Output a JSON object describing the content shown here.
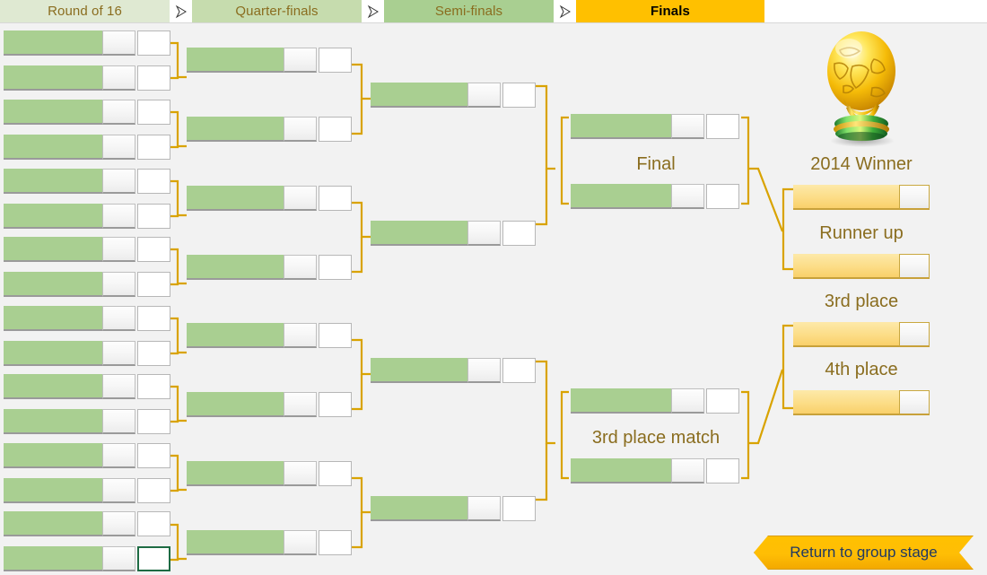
{
  "header": {
    "tabs": [
      {
        "label": "Round of 16",
        "key": "r16"
      },
      {
        "label": "Quarter-finals",
        "key": "qf"
      },
      {
        "label": "Semi-finals",
        "key": "sf"
      },
      {
        "label": "Finals",
        "key": "finals"
      }
    ],
    "separator_icon": "chevron-right-icon"
  },
  "labels": {
    "final": "Final",
    "third_place_match": "3rd place match",
    "winner": "2014 Winner",
    "runner_up": "Runner up",
    "third_place": "3rd place",
    "fourth_place": "4th place"
  },
  "trophy": {
    "icon": "world-cup-trophy-icon",
    "alt": "FIFA World Cup trophy"
  },
  "return_button": {
    "label": "Return to group stage",
    "icon": "chevron-banner-icon"
  },
  "bracket": {
    "round_of_16": {
      "matches": [
        {
          "slots": [
            {
              "team": "",
              "score": "",
              "pen": ""
            },
            {
              "team": "",
              "score": "",
              "pen": ""
            }
          ]
        },
        {
          "slots": [
            {
              "team": "",
              "score": "",
              "pen": ""
            },
            {
              "team": "",
              "score": "",
              "pen": ""
            }
          ]
        },
        {
          "slots": [
            {
              "team": "",
              "score": "",
              "pen": ""
            },
            {
              "team": "",
              "score": "",
              "pen": ""
            }
          ]
        },
        {
          "slots": [
            {
              "team": "",
              "score": "",
              "pen": ""
            },
            {
              "team": "",
              "score": "",
              "pen": ""
            }
          ]
        },
        {
          "slots": [
            {
              "team": "",
              "score": "",
              "pen": ""
            },
            {
              "team": "",
              "score": "",
              "pen": ""
            }
          ]
        },
        {
          "slots": [
            {
              "team": "",
              "score": "",
              "pen": ""
            },
            {
              "team": "",
              "score": "",
              "pen": ""
            }
          ]
        },
        {
          "slots": [
            {
              "team": "",
              "score": "",
              "pen": ""
            },
            {
              "team": "",
              "score": "",
              "pen": ""
            }
          ]
        },
        {
          "slots": [
            {
              "team": "",
              "score": "",
              "pen": ""
            },
            {
              "team": "",
              "score": "",
              "pen": "",
              "selected": true
            }
          ]
        }
      ]
    },
    "quarter_finals": {
      "matches": [
        {
          "slots": [
            {
              "team": "",
              "score": "",
              "pen": ""
            }
          ]
        },
        {
          "slots": [
            {
              "team": "",
              "score": "",
              "pen": ""
            }
          ]
        },
        {
          "slots": [
            {
              "team": "",
              "score": "",
              "pen": ""
            }
          ]
        },
        {
          "slots": [
            {
              "team": "",
              "score": "",
              "pen": ""
            }
          ]
        },
        {
          "slots": [
            {
              "team": "",
              "score": "",
              "pen": ""
            }
          ]
        },
        {
          "slots": [
            {
              "team": "",
              "score": "",
              "pen": ""
            }
          ]
        },
        {
          "slots": [
            {
              "team": "",
              "score": "",
              "pen": ""
            }
          ]
        },
        {
          "slots": [
            {
              "team": "",
              "score": "",
              "pen": ""
            }
          ]
        }
      ]
    },
    "semi_finals": {
      "matches": [
        {
          "slots": [
            {
              "team": "",
              "score": "",
              "pen": ""
            }
          ]
        },
        {
          "slots": [
            {
              "team": "",
              "score": "",
              "pen": ""
            }
          ]
        },
        {
          "slots": [
            {
              "team": "",
              "score": "",
              "pen": ""
            }
          ]
        },
        {
          "slots": [
            {
              "team": "",
              "score": "",
              "pen": ""
            }
          ]
        }
      ]
    },
    "final_match": {
      "slots": [
        {
          "team": "",
          "score": "",
          "pen": ""
        },
        {
          "team": "",
          "score": "",
          "pen": ""
        }
      ]
    },
    "third_place_match": {
      "slots": [
        {
          "team": "",
          "score": "",
          "pen": ""
        },
        {
          "team": "",
          "score": "",
          "pen": ""
        }
      ]
    },
    "podium": {
      "winner": {
        "team": "",
        "score": ""
      },
      "runner_up": {
        "team": "",
        "score": ""
      },
      "third_place": {
        "team": "",
        "score": ""
      },
      "fourth_place": {
        "team": "",
        "score": ""
      }
    }
  },
  "colors": {
    "team_green": "#a9cf91",
    "podium_gold": "#fcdd87",
    "wire": "#d9a300",
    "tab_finals": "#ffc000",
    "label_text": "#8a6d1f",
    "selection": "#1e6b43",
    "canvas": "#f2f2f2"
  }
}
